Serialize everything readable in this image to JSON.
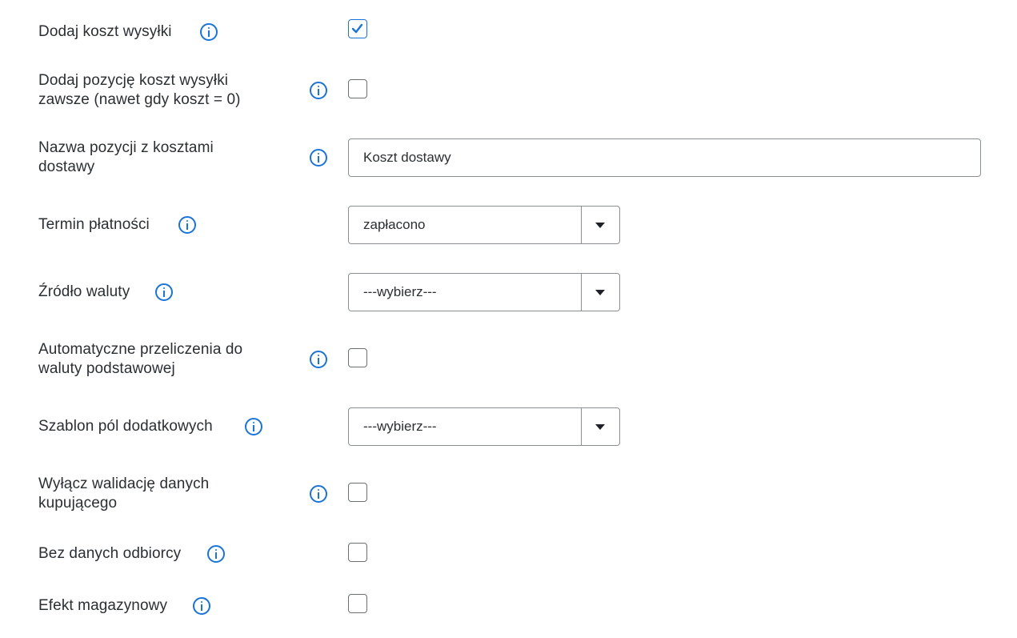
{
  "form": {
    "rows": [
      {
        "label": "Dodaj koszt wysyłki",
        "control": "checkbox",
        "checked": true
      },
      {
        "label_line1": "Dodaj pozycję koszt wysyłki",
        "label_line2": "zawsze (nawet gdy koszt = 0)",
        "control": "checkbox",
        "checked": false
      },
      {
        "label_line1": "Nazwa pozycji z kosztami",
        "label_line2": "dostawy",
        "control": "text",
        "value": "Koszt dostawy"
      },
      {
        "label": "Termin płatności",
        "control": "select",
        "value": "zapłacono"
      },
      {
        "label": "Źródło waluty",
        "control": "select",
        "value": "---wybierz---"
      },
      {
        "label_line1": "Automatyczne przeliczenia do",
        "label_line2": "waluty podstawowej",
        "control": "checkbox",
        "checked": false
      },
      {
        "label": "Szablon pól dodatkowych",
        "control": "select",
        "value": "---wybierz---"
      },
      {
        "label_line1": "Wyłącz walidację danych",
        "label_line2": "kupującego",
        "control": "checkbox",
        "checked": false
      },
      {
        "label": "Bez danych odbiorcy",
        "control": "checkbox",
        "checked": false
      },
      {
        "label": "Efekt magazynowy",
        "control": "checkbox",
        "checked": false
      }
    ]
  },
  "colors": {
    "accent": "#1a73d9",
    "text": "#2b2f33",
    "border": "#8a8f95"
  },
  "icons": {
    "info": "info-circle-icon",
    "check": "check-icon",
    "dropdown": "caret-down-icon"
  }
}
